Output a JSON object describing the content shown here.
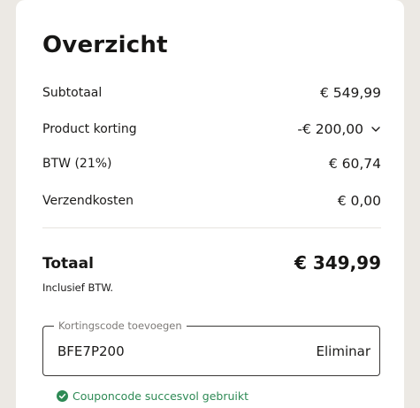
{
  "overview": {
    "title": "Overzicht",
    "rows": [
      {
        "label": "Subtotaal",
        "value": "€ 549,99"
      },
      {
        "label": "Product korting",
        "value": "-€ 200,00"
      },
      {
        "label": "BTW (21%)",
        "value": "€ 60,74"
      },
      {
        "label": "Verzendkosten",
        "value": "€ 0,00"
      }
    ],
    "total": {
      "label": "Totaal",
      "value": "€ 349,99",
      "note": "Inclusief BTW."
    }
  },
  "coupon": {
    "legend": "Kortingscode toevoegen",
    "value": "BFE7P200",
    "remove_label": "Eliminar",
    "status": "Couponcode succesvol gebruikt"
  },
  "icons": {
    "discount_toggle": "chevron-down-icon",
    "status": "check-circle-icon"
  },
  "colors": {
    "success": "#2e8a55",
    "background": "#ece9e4"
  }
}
